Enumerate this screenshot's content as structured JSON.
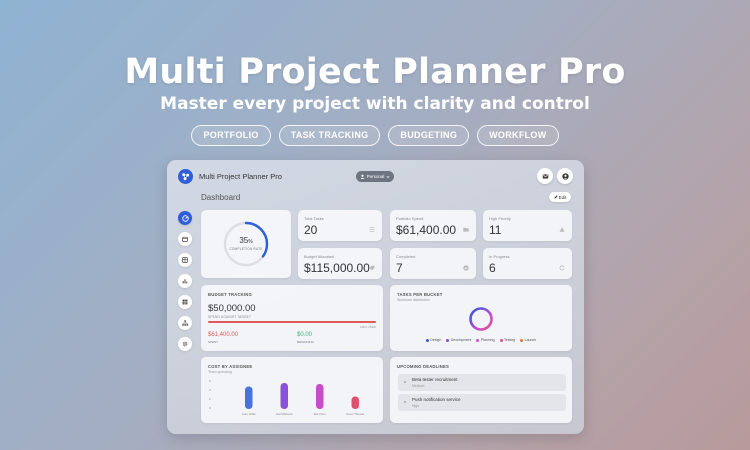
{
  "hero": {
    "title": "Multi Project Planner Pro",
    "subtitle": "Master every project with clarity and control",
    "pills": [
      "PORTFOLIO",
      "TASK TRACKING",
      "BUDGETING",
      "WORKFLOW"
    ]
  },
  "app": {
    "title": "Multi Project Planner Pro",
    "profile": "Personal",
    "page_title": "Dashboard",
    "edit_label": "Edit",
    "accent": "#2f5ed8"
  },
  "nav": [
    "dashboard-icon",
    "calendar-icon",
    "board-icon",
    "chart-icon",
    "grid-icon",
    "hierarchy-icon",
    "settings-icon"
  ],
  "completion": {
    "percent": 35,
    "percent_text": "35",
    "percent_sign": "%",
    "label": "COMPLETION RATE"
  },
  "stats": {
    "total_tasks": {
      "label": "Total Tasks",
      "value": "20"
    },
    "portfolio_spend": {
      "label": "Portfolio Spend",
      "value": "$61,400.00"
    },
    "high_priority": {
      "label": "High Priority",
      "value": "11"
    },
    "budget_allocated": {
      "label": "Budget Allocated",
      "value": "$115,000.00"
    },
    "completed": {
      "label": "Completed",
      "value": "7"
    },
    "in_progress": {
      "label": "In Progress",
      "value": "6"
    }
  },
  "budget": {
    "title": "BUDGET TRACKING",
    "amount": "$50,000.00",
    "caption": "SPEND AGAINST TARGET",
    "scale_max": "1M% USED",
    "spent_value": "$61,400.00",
    "spent_label": "SPENT",
    "remaining_value": "$0.00",
    "remaining_label": "REMAINING",
    "spent_color": "#e05a5a",
    "remaining_color": "#3fb27f"
  },
  "buckets": {
    "title": "TASKS PER BUCKET",
    "subtitle": "Workload distribution",
    "legend": [
      {
        "name": "Design",
        "color": "#2f5ed8"
      },
      {
        "name": "Development",
        "color": "#7a4fd8"
      },
      {
        "name": "Planning",
        "color": "#c94fd1"
      },
      {
        "name": "Testing",
        "color": "#e0507a"
      },
      {
        "name": "Launch",
        "color": "#e07a3a"
      }
    ]
  },
  "cost": {
    "title": "COST BY ASSIGNEE",
    "subtitle": "Team spending",
    "y_ticks": [
      "6",
      "4",
      "2",
      "0"
    ]
  },
  "deadlines": {
    "title": "UPCOMING DEADLINES",
    "items": [
      {
        "name": "Beta tester recruitment",
        "priority": "Medium"
      },
      {
        "name": "Push notification service",
        "priority": "High"
      }
    ]
  },
  "chart_data": {
    "type": "bar",
    "categories": [
      "Liam Hollis",
      "Ava Mathews",
      "Mia Chen",
      "Owen Thomas"
    ],
    "values": [
      4.5,
      5.2,
      5.0,
      2.5
    ],
    "colors": [
      "#4a72d9",
      "#8a52d6",
      "#c64cc8",
      "#e0506e"
    ],
    "ylim": [
      0,
      6
    ]
  }
}
